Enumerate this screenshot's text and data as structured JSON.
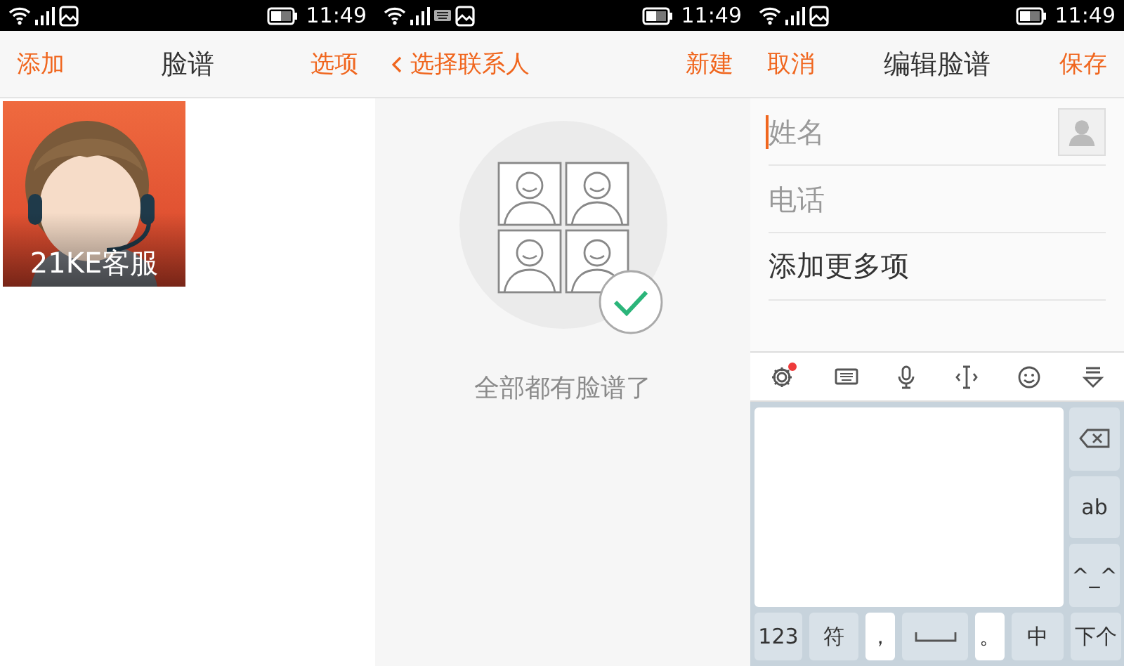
{
  "screens": [
    {
      "kind": "faces",
      "status_bar": {
        "time": "11:49",
        "keyboard_indicator": false
      },
      "header": {
        "left": "添加",
        "title": "脸谱",
        "right": "选项",
        "back": false
      },
      "faces": [
        {
          "name": "21KE客服"
        }
      ]
    },
    {
      "kind": "picker",
      "status_bar": {
        "time": "11:49",
        "keyboard_indicator": true
      },
      "header": {
        "left": "选择联系人",
        "right": "新建",
        "back": true
      },
      "empty_message": "全部都有脸谱了"
    },
    {
      "kind": "editor",
      "status_bar": {
        "time": "11:49",
        "keyboard_indicator": false
      },
      "header": {
        "left": "取消",
        "title": "编辑脸谱",
        "right": "保存",
        "back": false
      },
      "fields": [
        {
          "kind": "input",
          "placeholder": "姓名",
          "focused": true
        },
        {
          "kind": "input",
          "placeholder": "电话",
          "focused": false
        },
        {
          "kind": "action",
          "label": "添加更多项"
        }
      ],
      "keyboard": {
        "settings_badge": true,
        "side_keys": [
          {
            "kind": "backspace"
          },
          {
            "kind": "text",
            "label": "ab"
          },
          {
            "kind": "text",
            "label": "^_^"
          }
        ],
        "bottom_keys": [
          {
            "kind": "text",
            "label": "123"
          },
          {
            "kind": "text",
            "label": "符"
          },
          {
            "kind": "punct",
            "label": "，"
          },
          {
            "kind": "space"
          },
          {
            "kind": "punct",
            "label": "。"
          },
          {
            "kind": "text",
            "label": "中"
          },
          {
            "kind": "text",
            "label": "下个"
          }
        ]
      }
    }
  ]
}
